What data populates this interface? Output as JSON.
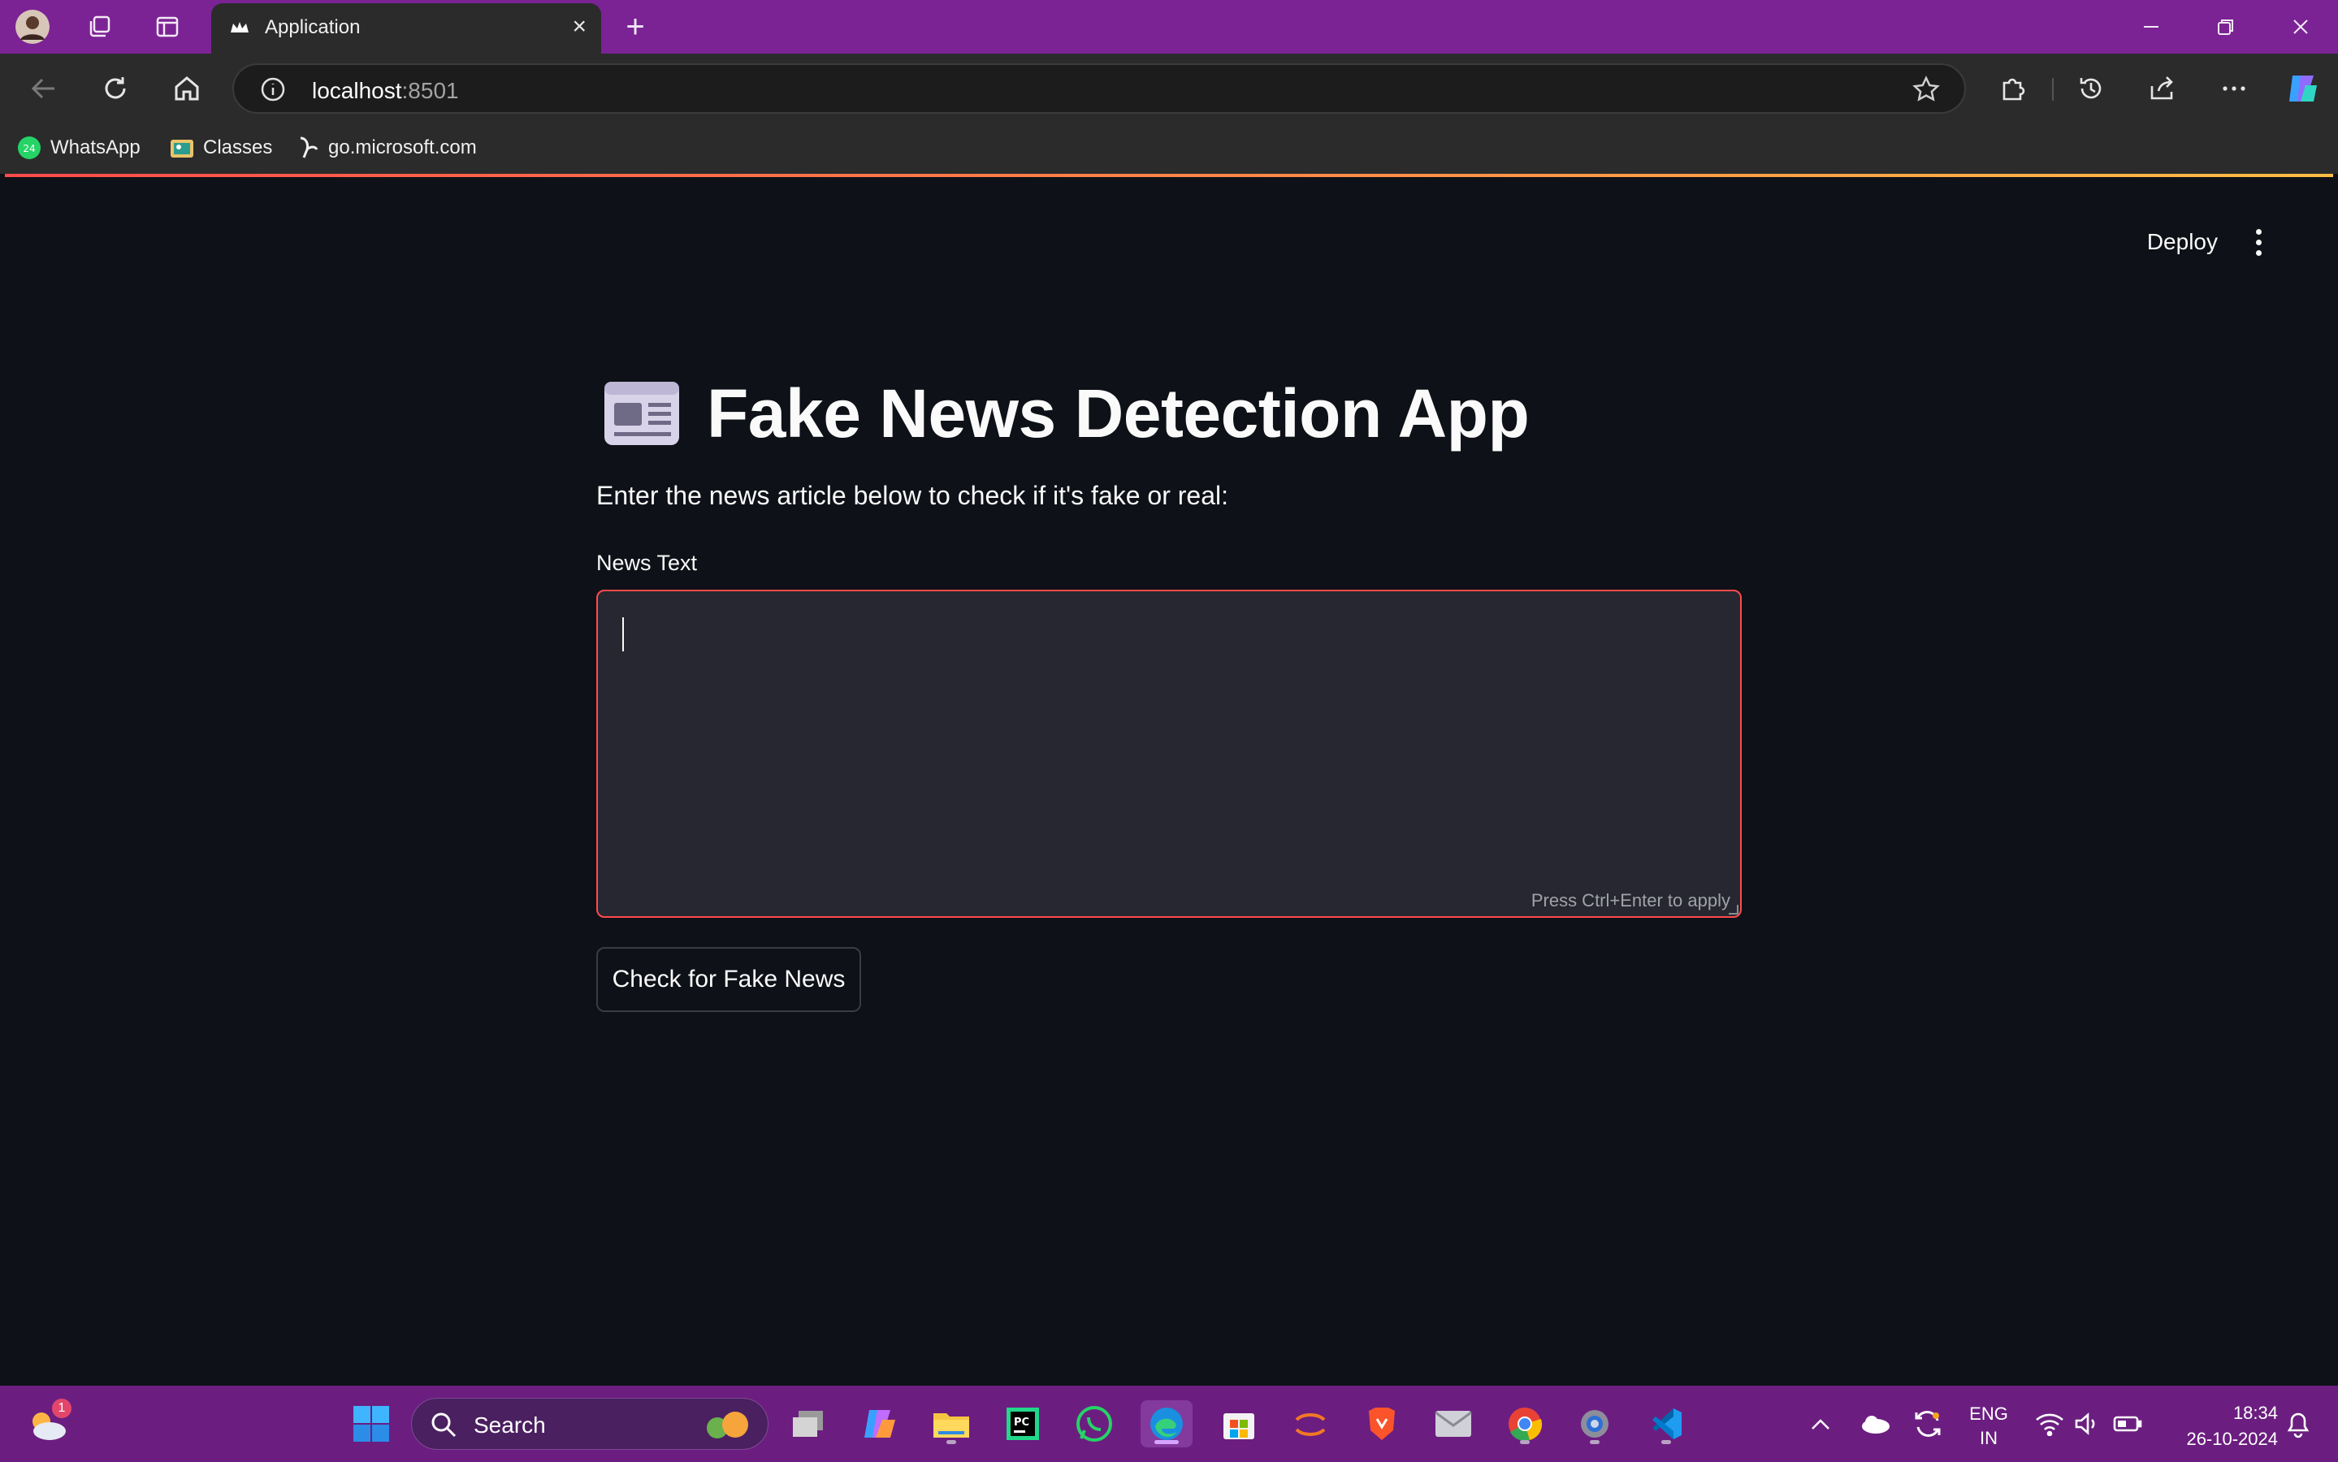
{
  "browser": {
    "tab_title": "Application",
    "new_tab_symbol": "+",
    "url_host": "localhost",
    "url_port": ":8501",
    "bookmarks": [
      {
        "label": "WhatsApp",
        "icon": "whatsapp-icon"
      },
      {
        "label": "Classes",
        "icon": "folder-icon"
      },
      {
        "label": "go.microsoft.com",
        "icon": "link-icon"
      }
    ],
    "accent_color": "#7b2394"
  },
  "app": {
    "deploy_label": "Deploy",
    "title": "Fake News Detection App",
    "title_icon": "newspaper-icon",
    "subtitle": "Enter the news article below to check if it's fake or real:",
    "field_label": "News Text",
    "input_value": "",
    "input_hint": "Press Ctrl+Enter to apply",
    "button_label": "Check for Fake News",
    "accent_color": "#ff4b4b",
    "background": "#0e1117"
  },
  "taskbar": {
    "weather_badge": "1",
    "search_label": "Search",
    "language_line1": "ENG",
    "language_line2": "IN",
    "time": "18:34",
    "date": "26-10-2024"
  }
}
